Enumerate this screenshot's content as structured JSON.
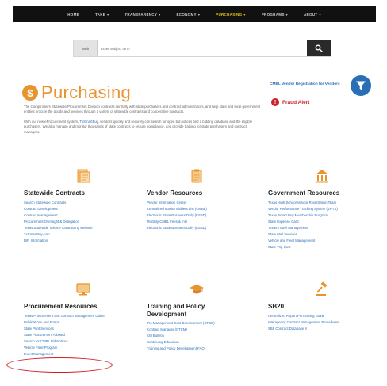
{
  "nav": {
    "items": [
      {
        "label": "HOME",
        "caret": false,
        "active": false
      },
      {
        "label": "TAKE",
        "caret": true,
        "active": false
      },
      {
        "label": "TRANSPARENCY",
        "caret": true,
        "active": false
      },
      {
        "label": "ECONOMY",
        "caret": true,
        "active": false
      },
      {
        "label": "PURCHASING",
        "caret": true,
        "active": true
      },
      {
        "label": "PROGRAMS",
        "caret": true,
        "active": false
      },
      {
        "label": "ABOUT",
        "caret": true,
        "active": false
      }
    ]
  },
  "search": {
    "filter_label": "Web",
    "placeholder": "Enter subject term"
  },
  "page": {
    "logo_letter": "$",
    "title": "Purchasing"
  },
  "intro": {
    "para1": "The Comptroller's Statewide Procurement Division contracts centrally with state purchasers and contract administrators, and help state and local government entities procure the goods and services through a variety of statewide contracts and cooperative contracts.",
    "para2_prefix": "With our new eProcurement system, ",
    "para2_link": "TxSmartBuy",
    "para2_suffix": ", vendors quickly and securely can search for open bid notices and a bidding database and the eligible purchasers. We also manage and monitor thousands of state contracts to ensure compliance, and provide training for state purchasers and contract managers."
  },
  "sidebar": {
    "cmbl_link": "CMBL Vendor Registration for Vendors",
    "fraud_label": "Fraud Alert"
  },
  "sections": {
    "statewide": {
      "title": "Statewide Contracts",
      "items": [
        "Search Statewide Contracts",
        "Contract Development",
        "Contract Management",
        "Procurement Oversight & Delegation",
        "Texas Statewide Volume Contracting Website",
        "TxSmartBuy.com",
        "DIR Information"
      ]
    },
    "vendor": {
      "title": "Vendor Resources",
      "items": [
        "Vendor Information Center",
        "Centralized Master Bidders List (CMBL)",
        "Electronic State Business Daily (ESBD)",
        "Monthly CMBL Fees & Info",
        "Electronic State Business Daily (ESBD)"
      ]
    },
    "government": {
      "title": "Government Resources",
      "items": [
        "Texas High School Vendor Registration Team",
        "Vendor Performance Tracking System (VPTS)",
        "Texas Smart Buy Membership Program",
        "State Expense Card",
        "Texas Travel Management",
        "State Mail Services",
        "Vehicle and Fleet Management",
        "State Trip Cost"
      ]
    },
    "procurement": {
      "title": "Procurement Resources",
      "items": [
        "Texas Procurement and Contract Management Guide",
        "Publications and Forms",
        "State Print Services",
        "State Procurement Allowed",
        "Search for CMBL Bid Notices",
        "Vehicle Fleet Program",
        "Event Management"
      ]
    },
    "training": {
      "title": "Training and Policy Development",
      "items": [
        "Pro Management Cont Development (CTCD)",
        "Contract Manager (CTCM)",
        "CM Bulletin",
        "Continuing Education",
        "Training and Policy Development FAQ"
      ]
    },
    "sb20": {
      "title": "SB20",
      "items": [
        "Centralized Report Purchasing Guide",
        "Interagency Contract Management Procedures",
        "SB8 Contract Database 8"
      ]
    }
  },
  "colors": {
    "accent_orange": "#e8942e",
    "link_blue": "#2a6fb5",
    "alert_red": "#c8242a",
    "nav_bg": "#111111",
    "nav_active": "#e0c020"
  }
}
